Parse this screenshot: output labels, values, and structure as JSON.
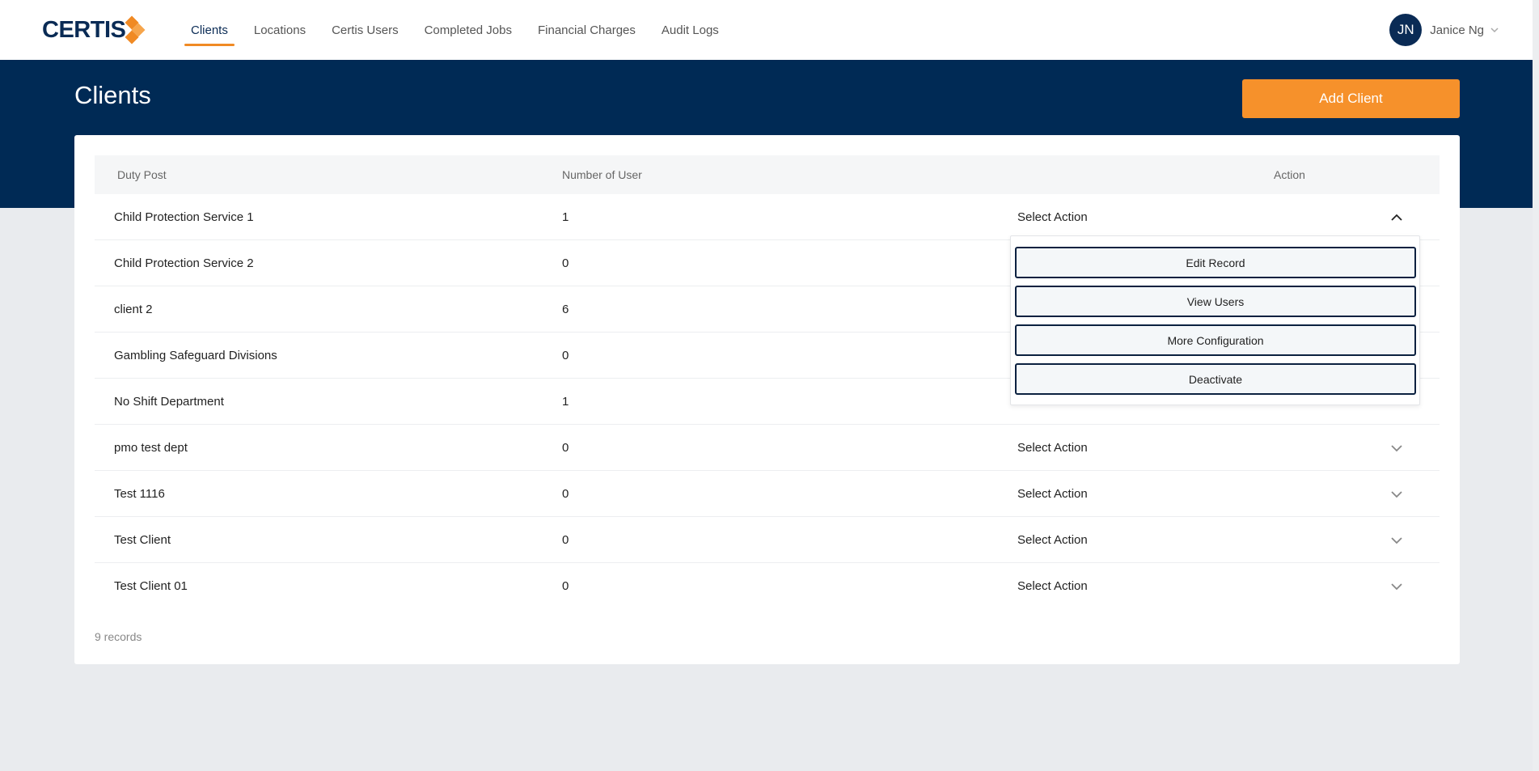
{
  "brand": {
    "logo_text": "CERTIS"
  },
  "nav": {
    "items": [
      {
        "label": "Clients",
        "active": true
      },
      {
        "label": "Locations"
      },
      {
        "label": "Certis Users"
      },
      {
        "label": "Completed Jobs"
      },
      {
        "label": "Financial Charges"
      },
      {
        "label": "Audit Logs"
      }
    ]
  },
  "user": {
    "initials": "JN",
    "name": "Janice Ng"
  },
  "page": {
    "title": "Clients",
    "add_label": "Add Client"
  },
  "table": {
    "headers": {
      "duty_post": "Duty Post",
      "num_users": "Number of User",
      "action": "Action"
    },
    "rows": [
      {
        "name": "Child Protection Service 1",
        "users": "1",
        "action": "Select Action",
        "expanded": true
      },
      {
        "name": "Child Protection Service 2",
        "users": "0",
        "action": "Select Action"
      },
      {
        "name": "client 2",
        "users": "6",
        "action": "Select Action"
      },
      {
        "name": "Gambling Safeguard Divisions",
        "users": "0",
        "action": "Select Action"
      },
      {
        "name": "No Shift Department",
        "users": "1",
        "action": "Select Action"
      },
      {
        "name": "pmo test dept",
        "users": "0",
        "action": "Select Action"
      },
      {
        "name": "Test 1116",
        "users": "0",
        "action": "Select Action"
      },
      {
        "name": "Test Client",
        "users": "0",
        "action": "Select Action"
      },
      {
        "name": "Test Client 01",
        "users": "0",
        "action": "Select Action"
      }
    ],
    "footer": "9 records"
  },
  "dropdown": {
    "items": [
      "Edit Record",
      "View Users",
      "More Configuration",
      "Deactivate"
    ]
  },
  "colors": {
    "navy": "#002a55",
    "accent": "#f6912b"
  }
}
